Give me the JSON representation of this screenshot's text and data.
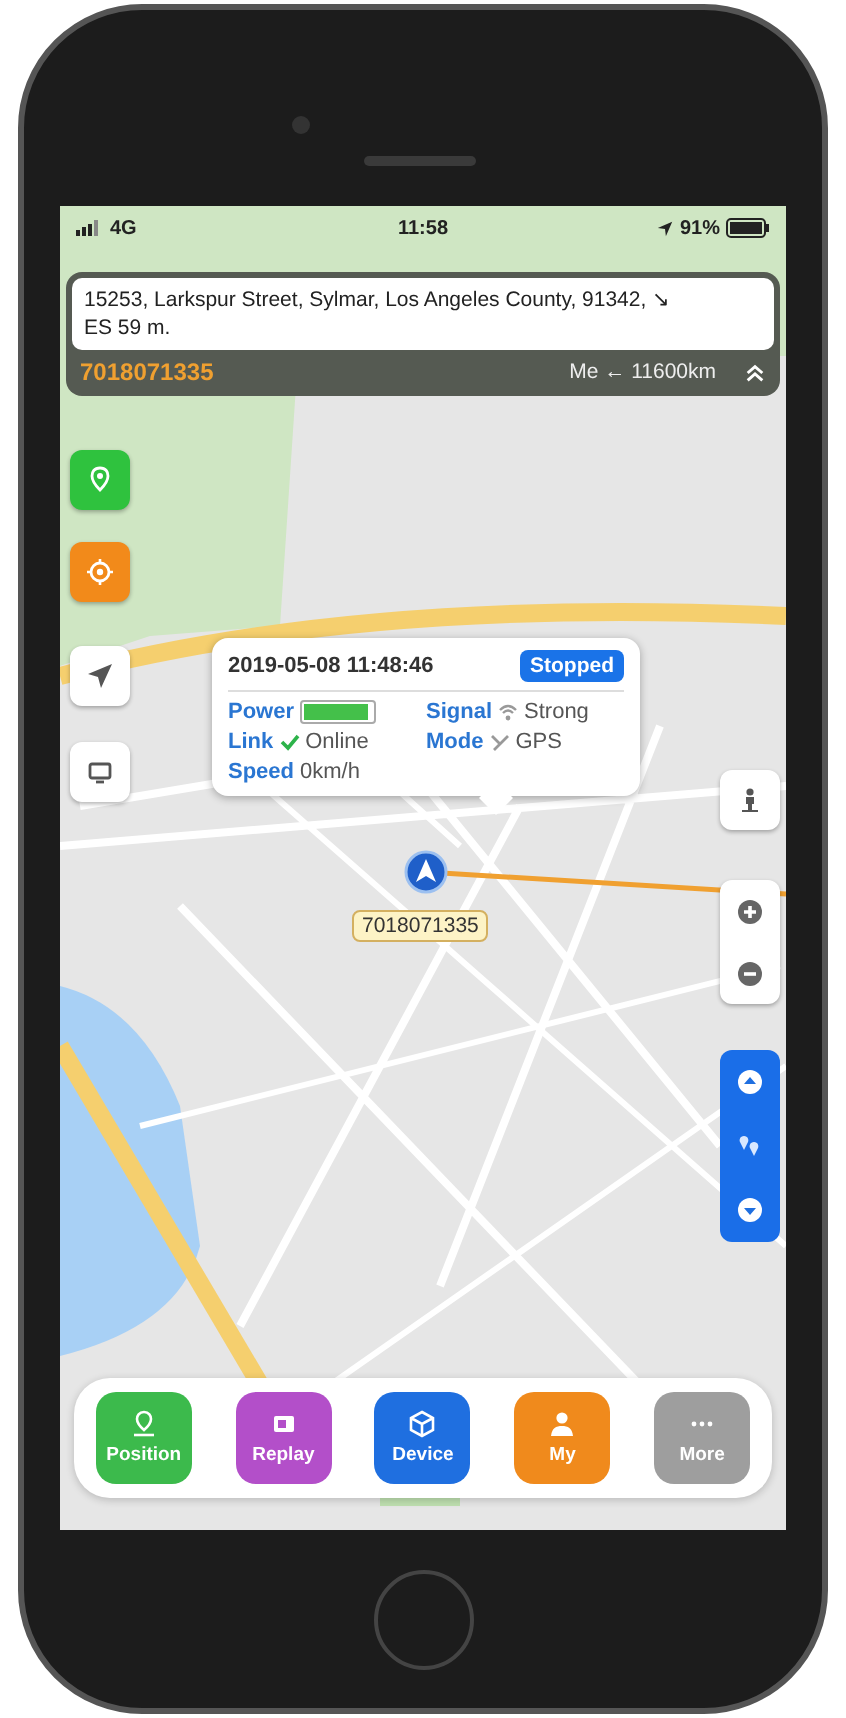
{
  "status_bar": {
    "network": "4G",
    "time": "11:58",
    "battery": "91%"
  },
  "address_panel": {
    "address": "15253, Larkspur Street, Sylmar, Los Angeles County, 91342, ↘ ES 59 m.",
    "device_id": "7018071335",
    "distance": "Me ← 11600km"
  },
  "popup": {
    "time": "2019-05-08 11:48:46",
    "status": "Stopped",
    "fields": [
      {
        "label": "Power",
        "kind": "battery",
        "level": 0.95
      },
      {
        "label": "Signal",
        "kind": "signal",
        "value": "Strong"
      },
      {
        "label": "Link",
        "kind": "link",
        "value": "Online"
      },
      {
        "label": "Mode",
        "kind": "mode",
        "value": "GPS"
      },
      {
        "label": "Speed",
        "kind": "text",
        "value": "0km/h"
      }
    ]
  },
  "marker": {
    "label": "7018071335"
  },
  "tabs": [
    {
      "label": "Position",
      "color": "#3cba4c"
    },
    {
      "label": "Replay",
      "color": "#b34fc9"
    },
    {
      "label": "Device",
      "color": "#1f6fe0"
    },
    {
      "label": "My",
      "color": "#f08a1c"
    },
    {
      "label": "More",
      "color": "#9e9e9e"
    }
  ]
}
